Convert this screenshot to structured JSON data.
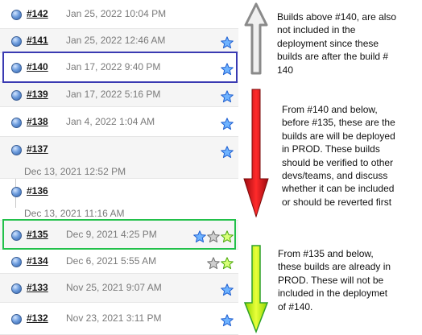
{
  "builds": [
    {
      "number": "#142",
      "date": "Jan 25, 2022 10:04 PM",
      "stars": []
    },
    {
      "number": "#141",
      "date": "Jan 25, 2022 12:46 AM",
      "stars": [
        "blue-star-icon"
      ]
    },
    {
      "number": "#140",
      "date": "Jan 17, 2022 9:40 PM",
      "stars": [
        "blue-star-icon"
      ]
    },
    {
      "number": "#139",
      "date": "Jan 17, 2022 5:16 PM",
      "stars": [
        "blue-star-icon"
      ]
    },
    {
      "number": "#138",
      "date": "Jan 4, 2022 1:04 AM",
      "stars": [
        "blue-star-icon"
      ]
    },
    {
      "number": "#137",
      "date": "Dec 13, 2021 12:52 PM",
      "stars": [
        "blue-star-icon"
      ]
    },
    {
      "number": "#136",
      "date": "Dec 13, 2021 11:16 AM",
      "stars": []
    },
    {
      "number": "#135",
      "date": "Dec 9, 2021 4:25 PM",
      "stars": [
        "blue-star-icon",
        "gray-star-icon",
        "green-star-icon"
      ]
    },
    {
      "number": "#134",
      "date": "Dec 6, 2021 5:55 AM",
      "stars": [
        "gray-star-icon",
        "green-star-icon"
      ]
    },
    {
      "number": "#133",
      "date": "Nov 25, 2021 9:07 AM",
      "stars": [
        "blue-star-icon"
      ]
    },
    {
      "number": "#132",
      "date": "Nov 23, 2021 3:11 PM",
      "stars": [
        "blue-star-icon"
      ]
    }
  ],
  "notes": {
    "above": "Builds above #140, are also\nnot included in the\ndeployment since these\nbuilds are after the build #\n140",
    "middle": "From #140 and below,\nbefore #135, these are the\nbuilds are will be deployed\nin PROD. These builds\nshould be verified to other\ndevs/teams, and discuss\nwhether it can be included\nor should be reverted first",
    "below": "From #135 and below,\nthese builds are already in\nPROD. These will not be\nincluded in the deploymet\nof #140."
  },
  "colors": {
    "highlight_140": "#3a3ab2",
    "highlight_135": "#22c04a",
    "arrow_up": "#8a8a8a",
    "arrow_middle": "#e0121a",
    "arrow_down": "#c6ff1a"
  },
  "icons": {
    "build_status": "blue-ball-icon",
    "arrow_up": "gray-up-arrow-icon",
    "arrow_middle": "red-down-arrow-icon",
    "arrow_down": "green-down-arrow-icon"
  }
}
